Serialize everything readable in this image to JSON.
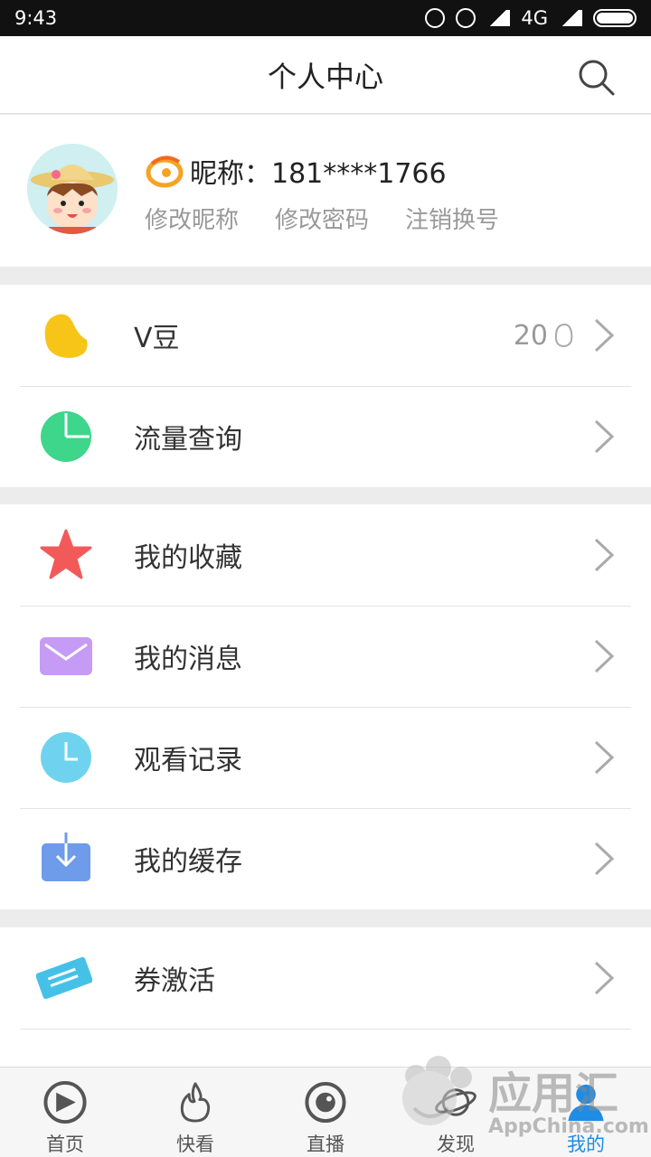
{
  "status_bar": {
    "time": "9:43",
    "network": "4G"
  },
  "header": {
    "title": "个人中心",
    "search_icon": "search-icon"
  },
  "profile": {
    "nickname": "昵称：181****1766",
    "actions": [
      "修改昵称",
      "修改密码",
      "注销换号"
    ]
  },
  "menu": {
    "vbeans": {
      "label": "V豆",
      "value": "20",
      "icon": "bean-icon",
      "color": "#f7c518"
    },
    "traffic": {
      "label": "流量查询",
      "icon": "pie-chart-icon",
      "color": "#3dd68a"
    },
    "favorites": {
      "label": "我的收藏",
      "icon": "star-icon",
      "color": "#f25a5a"
    },
    "messages": {
      "label": "我的消息",
      "icon": "envelope-icon",
      "color": "#c59bf5"
    },
    "history": {
      "label": "观看记录",
      "icon": "clock-icon",
      "color": "#6fd3ef"
    },
    "cache": {
      "label": "我的缓存",
      "icon": "download-icon",
      "color": "#6e9bea"
    },
    "coupon": {
      "label": "券激活",
      "icon": "ticket-icon",
      "color": "#45c1e8"
    }
  },
  "tabbar": {
    "items": [
      {
        "label": "首页",
        "icon": "play-icon"
      },
      {
        "label": "快看",
        "icon": "flame-icon"
      },
      {
        "label": "直播",
        "icon": "eye-icon"
      },
      {
        "label": "发现",
        "icon": "planet-icon"
      },
      {
        "label": "我的",
        "icon": "person-icon",
        "active": true
      }
    ]
  },
  "watermark": {
    "title": "应用汇",
    "subtitle": "AppChina.com"
  }
}
